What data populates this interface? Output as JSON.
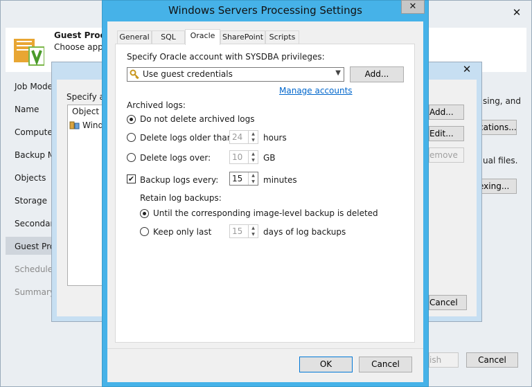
{
  "wizard": {
    "title_partial": "Guest Proces",
    "subtitle_partial": "Choose appli",
    "nav": [
      {
        "label": "Job Mode"
      },
      {
        "label": "Name"
      },
      {
        "label": "Computer"
      },
      {
        "label": "Backup M"
      },
      {
        "label": "Objects"
      },
      {
        "label": "Storage"
      },
      {
        "label": "Secondary"
      },
      {
        "label": "Guest Pro"
      },
      {
        "label": "Schedule"
      },
      {
        "label": "Summary"
      }
    ],
    "right_text_1": "sing, and",
    "right_text_2": "ual files.",
    "finish_label": "ish",
    "cancel_label": "Cancel"
  },
  "middle": {
    "specify_label": "Specify ap",
    "column_object": "Object",
    "row_1": "Wind",
    "buttons": {
      "add": "Add...",
      "edit": "Edit...",
      "remove": "emove",
      "applications": "cations...",
      "indexing": "exing...",
      "cancel": "Cancel"
    }
  },
  "dialog": {
    "title": "Windows Servers Processing Settings",
    "tabs": [
      "General",
      "SQL",
      "Oracle",
      "SharePoint",
      "Scripts"
    ],
    "active_tab": "Oracle",
    "account_label": "Specify Oracle account with SYSDBA privileges:",
    "account_value": "Use guest credentials",
    "add_button": "Add...",
    "manage_link": "Manage accounts",
    "archived_logs_label": "Archived logs:",
    "opt_no_delete": "Do not delete archived logs",
    "opt_older": "Delete logs older than:",
    "older_value": "24",
    "older_unit": "hours",
    "opt_over": "Delete logs over:",
    "over_value": "10",
    "over_unit": "GB",
    "backup_logs_label": "Backup logs every:",
    "backup_logs_value": "15",
    "backup_logs_unit": "minutes",
    "retain_label": "Retain log backups:",
    "opt_until": "Until the corresponding image-level backup is deleted",
    "opt_keep": "Keep only last",
    "keep_value": "15",
    "keep_unit": "days of log backups",
    "ok_button": "OK",
    "cancel_button": "Cancel"
  }
}
